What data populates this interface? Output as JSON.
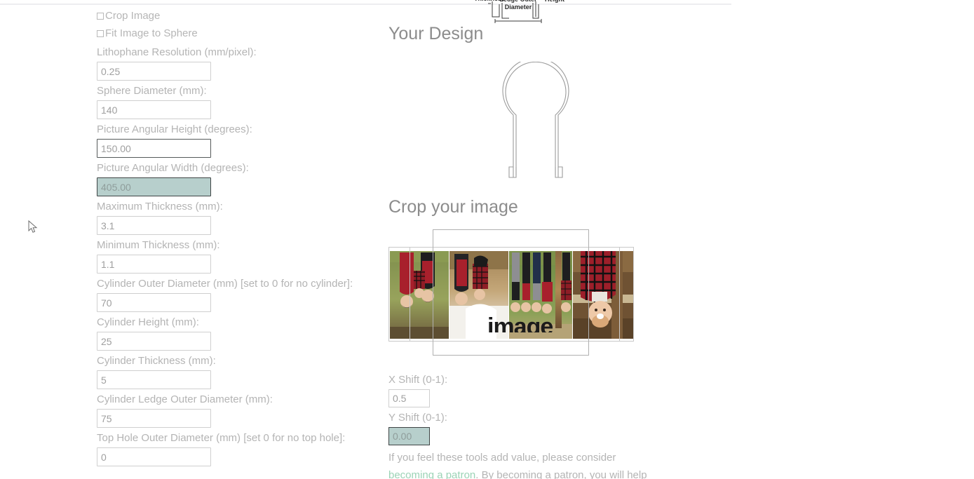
{
  "left_form": {
    "checkboxes": [
      {
        "label": "Crop Image",
        "checked": false
      },
      {
        "label": "Fit Image to Sphere",
        "checked": false
      }
    ],
    "fields": [
      {
        "label": "Lithophane Resolution (mm/pixel):",
        "value": "0.25",
        "state": "normal"
      },
      {
        "label": "Sphere Diameter (mm):",
        "value": "140",
        "state": "normal"
      },
      {
        "label": "Picture Angular Height (degrees):",
        "value": "150.00",
        "state": "focused"
      },
      {
        "label": "Picture Angular Width (degrees):",
        "value": "405.00",
        "state": "selected"
      },
      {
        "label": "Maximum Thickness (mm):",
        "value": "3.1",
        "state": "normal"
      },
      {
        "label": "Minimum Thickness (mm):",
        "value": "1.1",
        "state": "normal"
      },
      {
        "label": "Cylinder Outer Diameter (mm) [set to 0 for no cylinder]:",
        "value": "70",
        "state": "normal"
      },
      {
        "label": "Cylinder Height (mm):",
        "value": "25",
        "state": "normal"
      },
      {
        "label": "Cylinder Thickness (mm):",
        "value": "5",
        "state": "normal"
      },
      {
        "label": "Cylinder Ledge Outer Diameter (mm):",
        "value": "75",
        "state": "normal"
      },
      {
        "label": "Top Hole Outer Diameter (mm) [set 0 for no top hole]:",
        "value": "0",
        "state": "normal"
      }
    ]
  },
  "diagram": {
    "labels": [
      {
        "text": "Cylinder Thickness"
      },
      {
        "text": "Cylinder Ledge Outer Diameter"
      },
      {
        "text": "Cylinder Height"
      }
    ]
  },
  "right_col": {
    "design_title": "Your Design",
    "crop_title": "Crop your image",
    "crop_watermark": "image",
    "shift_fields": [
      {
        "label": "X Shift (0-1):",
        "value": "0.5",
        "state": "normal"
      },
      {
        "label": "Y Shift (0-1):",
        "value": "0.00",
        "state": "selected"
      }
    ],
    "patron": {
      "line1": "If you feel these tools add value, please consider",
      "link": "becoming a patron",
      "line2_rest": ". By becoming a patron, you will help"
    }
  },
  "colors": {
    "selection_bg": "#b7cfcc",
    "label_gray": "#b4b4b4",
    "heading_gray": "#8c8c8c",
    "link_green": "#9bd3b6",
    "input_border": "#cfcfcf"
  }
}
